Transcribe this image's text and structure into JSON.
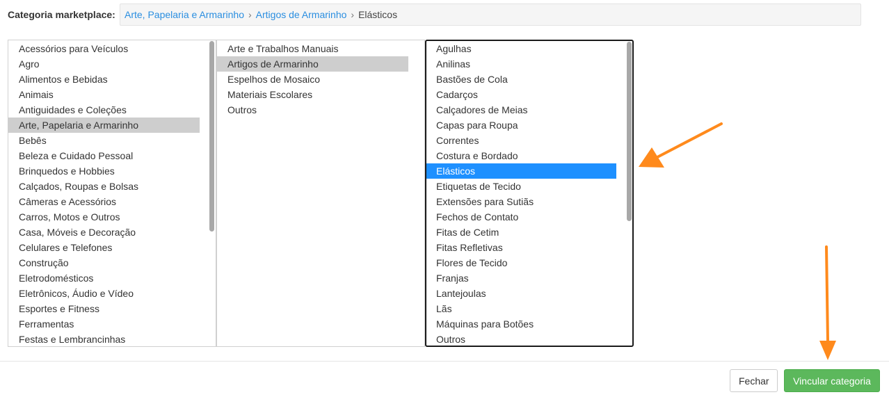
{
  "category": {
    "label": "Categoria marketplace:",
    "breadcrumb": {
      "level1": "Arte, Papelaria e Armarinho",
      "level2": "Artigos de Armarinho",
      "current": "Elásticos",
      "separator": "›"
    }
  },
  "lists": {
    "level1": {
      "selected": "Arte, Papelaria e Armarinho",
      "items": [
        "Acessórios para Veículos",
        "Agro",
        "Alimentos e Bebidas",
        "Animais",
        "Antiguidades e Coleções",
        "Arte, Papelaria e Armarinho",
        "Bebês",
        "Beleza e Cuidado Pessoal",
        "Brinquedos e Hobbies",
        "Calçados, Roupas e Bolsas",
        "Câmeras e Acessórios",
        "Carros, Motos e Outros",
        "Casa, Móveis e Decoração",
        "Celulares e Telefones",
        "Construção",
        "Eletrodomésticos",
        "Eletrônicos, Áudio e Vídeo",
        "Esportes e Fitness",
        "Ferramentas",
        "Festas e Lembrancinhas"
      ]
    },
    "level2": {
      "selected": "Artigos de Armarinho",
      "items": [
        "Arte e Trabalhos Manuais",
        "Artigos de Armarinho",
        "Espelhos de Mosaico",
        "Materiais Escolares",
        "Outros"
      ]
    },
    "level3": {
      "selected": "Elásticos",
      "items": [
        "Agulhas",
        "Anilinas",
        "Bastões de Cola",
        "Cadarços",
        "Calçadores de Meias",
        "Capas para Roupa",
        "Correntes",
        "Costura e Bordado",
        "Elásticos",
        "Etiquetas de Tecido",
        "Extensões para Sutiãs",
        "Fechos de Contato",
        "Fitas de Cetim",
        "Fitas Refletivas",
        "Flores de Tecido",
        "Franjas",
        "Lantejoulas",
        "Lãs",
        "Máquinas para Botões",
        "Outros"
      ]
    }
  },
  "footer": {
    "close_label": "Fechar",
    "link_label": "Vincular categoria"
  },
  "colors": {
    "accent_green": "#5cb85c",
    "selection_blue": "#1e90ff",
    "selection_gray": "#cecece",
    "link_blue": "#2a8ee0",
    "annotation_orange": "#ff8a1c"
  }
}
